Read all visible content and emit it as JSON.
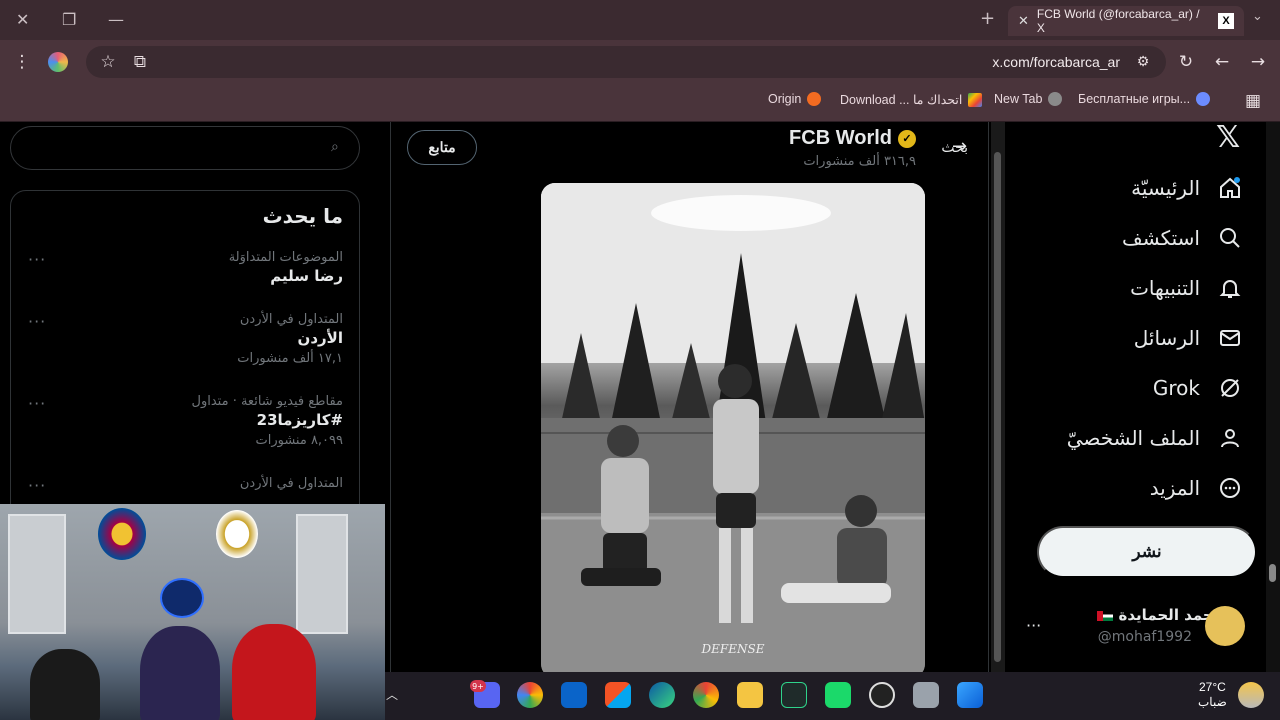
{
  "browser": {
    "tab_title": "FCB World (@forcabarca_ar) / X",
    "url": "x.com/forcabarca_ar",
    "bookmarks": [
      {
        "label": "Origin"
      },
      {
        "label": "Download ... اتحداك ما"
      },
      {
        "label": "New Tab"
      },
      {
        "label": "Бесплатные игры..."
      }
    ]
  },
  "left_panel": {
    "search_placeholder": "بحث",
    "trends_title": "ما يحدث",
    "trends": [
      {
        "context": "الموضوعات المتداوَلة",
        "name": "رضا سليم",
        "count": ""
      },
      {
        "context": "المتداول في الأردن",
        "name": "الأردن",
        "count": "١٧,١ ألف منشورات"
      },
      {
        "context": "مقاطع فيديو شائعة · متداول",
        "name": "#كاريزما23",
        "count": "٨,٠٩٩ منشورات"
      },
      {
        "context": "المتداول في الأردن",
        "name": "",
        "count": ""
      }
    ],
    "more_label": "···"
  },
  "profile": {
    "name": "FCB World",
    "posts_count": "٣١٦,٩ ألف منشورات",
    "follow_label": "متابع",
    "photo_caption": "DEFENSE"
  },
  "nav": {
    "items": [
      {
        "label": "الرئيسيّة",
        "icon": "home-icon"
      },
      {
        "label": "استكشف",
        "icon": "search-icon"
      },
      {
        "label": "التنبيهات",
        "icon": "bell-icon"
      },
      {
        "label": "الرسائل",
        "icon": "mail-icon"
      },
      {
        "label": "Grok",
        "icon": "grok-icon"
      },
      {
        "label": "الملف الشخصيّ",
        "icon": "person-icon"
      },
      {
        "label": "المزيد",
        "icon": "more-circle-icon"
      }
    ],
    "post_label": "نشر",
    "account_name": "محمد الحمايدة",
    "account_handle": "@mohaf1992"
  },
  "taskbar": {
    "notification_badge": "9+",
    "temperature": "27°C",
    "weather_text": "ضباب"
  },
  "colors": {
    "browser_bg": "#4a343b",
    "x_bg": "#000000",
    "post_button": "#eff3f4",
    "verified_badge": "#e2b719"
  }
}
